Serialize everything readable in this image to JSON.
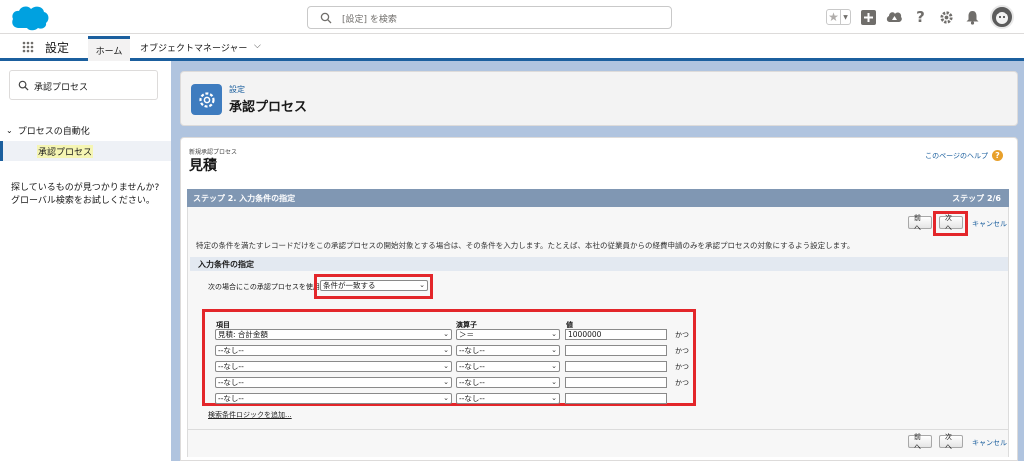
{
  "header": {
    "search_placeholder": "[設定] を検索"
  },
  "nav": {
    "app_name": "設定",
    "tabs": [
      {
        "label": "ホーム"
      },
      {
        "label": "オブジェクトマネージャー"
      }
    ]
  },
  "sidebar": {
    "search_value": "承認プロセス",
    "group_label": "プロセスの自動化",
    "item_label": "承認プロセス",
    "help_text": "探しているものが見つかりませんか? グローバル検索をお試しください。"
  },
  "title_card": {
    "breadcrumb": "設定",
    "title": "承認プロセス"
  },
  "page": {
    "sub_caption": "新規承認プロセス",
    "title": "見積",
    "help_link": "このページのヘルプ",
    "step_label": "ステップ 2. 入力条件の指定",
    "step_count": "ステップ 2/6",
    "buttons": {
      "prev": "前へ",
      "next": "次へ",
      "cancel": "キャンセル"
    },
    "intro": "特定の条件を満たすレコードだけをこの承認プロセスの開始対象とする場合は、その条件を入力します。たとえば、本社の従業員からの経費申請のみを承認プロセスの対象にするよう設定します。",
    "section_title": "入力条件の指定",
    "use_label": "次の場合にこの承認プロセスを使用",
    "use_value": "条件が一致する",
    "columns": {
      "field": "項目",
      "operator": "演算子",
      "value": "値"
    },
    "rows": [
      {
        "field": "見積: 合計金額",
        "operator": "＞＝",
        "value": "1000000",
        "connector": "かつ"
      },
      {
        "field": "--なし--",
        "operator": "--なし--",
        "value": "",
        "connector": "かつ"
      },
      {
        "field": "--なし--",
        "operator": "--なし--",
        "value": "",
        "connector": "かつ"
      },
      {
        "field": "--なし--",
        "operator": "--なし--",
        "value": "",
        "connector": "かつ"
      },
      {
        "field": "--なし--",
        "operator": "--なし--",
        "value": "",
        "connector": ""
      }
    ],
    "add_logic": "検索条件ロジックを追加..."
  },
  "colors": {
    "accent": "#1b5f9e",
    "highlight_border": "#e3262a",
    "step_bar": "#8097b3",
    "background": "#b0c4df"
  }
}
